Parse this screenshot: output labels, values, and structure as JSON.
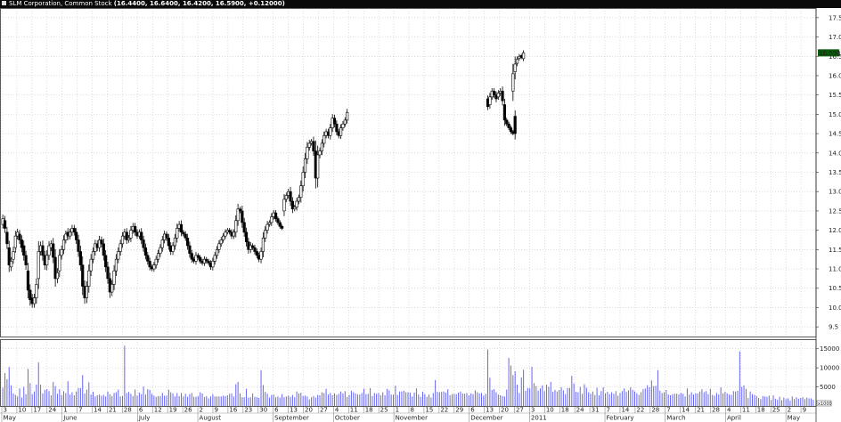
{
  "window": {
    "title": "SLM Corporation, Common Stock",
    "stats": "(16.4400, 16.6400, 16.4200, 16.5900, +0.12000)"
  },
  "colors": {
    "background": "#ffffff",
    "up_candle_fill": "#ffffff",
    "down_candle_fill": "#000000",
    "candle_outline": "#000000",
    "volume_bar": "#6666ee",
    "price_badge": "#0a5a0a",
    "grid": "#c8c8c8"
  },
  "chart_data": [
    {
      "type": "candlestick",
      "series_name": "SLM Corporation, Common Stock",
      "ylim": [
        9.25,
        17.75
      ],
      "y_ticks": [
        "9.5",
        "10.0",
        "10.5",
        "11.0",
        "11.5",
        "12.0",
        "12.5",
        "13.0",
        "13.5",
        "14.0",
        "14.5",
        "15.0",
        "15.5",
        "16.0",
        "16.5",
        "17.0",
        "17.5"
      ],
      "last_price_label": "16.5900",
      "grid": true,
      "segments": [
        {
          "start": 20100503,
          "count": 165,
          "close": [
            12.3,
            12.05,
            11.65,
            11.1,
            11.2,
            11.45,
            11.85,
            11.95,
            11.75,
            11.55,
            11.35,
            11.1,
            10.45,
            10.2,
            10.1,
            10.25,
            10.6,
            11.45,
            11.6,
            11.35,
            11.1,
            11.35,
            11.6,
            11.65,
            11.3,
            10.75,
            10.9,
            11.35,
            11.5,
            11.75,
            11.9,
            11.85,
            11.95,
            12.05,
            11.95,
            11.75,
            11.45,
            11.1,
            10.55,
            10.25,
            10.55,
            10.95,
            11.25,
            11.45,
            11.65,
            11.55,
            11.75,
            11.65,
            11.35,
            11.05,
            10.75,
            10.4,
            10.6,
            10.95,
            11.25,
            11.45,
            11.65,
            11.85,
            11.95,
            11.75,
            11.8,
            12.0,
            12.1,
            11.95,
            11.85,
            11.95,
            11.75,
            11.55,
            11.35,
            11.2,
            11.05,
            11.0,
            11.1,
            11.25,
            11.4,
            11.55,
            11.75,
            11.9,
            11.8,
            11.6,
            11.45,
            11.6,
            11.8,
            12.05,
            12.15,
            11.95,
            11.9,
            11.8,
            11.6,
            11.4,
            11.25,
            11.2,
            11.35,
            11.3,
            11.2,
            11.15,
            11.25,
            11.2,
            11.15,
            11.05,
            11.2,
            11.35,
            11.5,
            11.65,
            11.75,
            11.85,
            11.95,
            12.0,
            11.95,
            11.85,
            11.95,
            12.25,
            12.55,
            12.5,
            12.2,
            11.95,
            11.7,
            11.5,
            11.6,
            11.55,
            11.45,
            11.35,
            11.25,
            11.45,
            11.8,
            12.0,
            12.15,
            12.2,
            12.35,
            12.45,
            12.3,
            12.2,
            12.1,
            12.05,
            12.8,
            12.9,
            13.0,
            12.75,
            12.55,
            12.6,
            12.75,
            12.85,
            13.15,
            13.5,
            13.85,
            14.15,
            14.25,
            14.3,
            14.05,
            13.35,
            13.95,
            14.05,
            14.25,
            14.45,
            14.55,
            14.45,
            14.65,
            14.9,
            14.75,
            14.55,
            14.45,
            14.65,
            14.75,
            14.85,
            15.05
          ],
          "open_offset": [
            -0.15,
            0.2,
            0.3,
            0.45,
            -0.15,
            -0.2,
            -0.3,
            -0.1,
            0.15,
            0.2,
            0.25,
            0.25,
            0.5,
            0.25,
            0.15,
            -0.15,
            -0.35,
            -0.7,
            -0.15,
            0.25,
            0.25,
            -0.25,
            -0.25,
            -0.1,
            0.35,
            0.55,
            -0.15,
            -0.4,
            -0.15,
            -0.25,
            -0.15,
            0.1,
            -0.1,
            -0.1,
            0.1,
            0.2,
            0.3,
            0.35,
            0.55,
            0.3,
            -0.3,
            -0.4,
            -0.3,
            -0.2,
            -0.2,
            0.1,
            -0.2,
            0.1,
            0.3,
            0.3,
            0.3,
            0.35,
            -0.2,
            -0.35,
            -0.3,
            -0.2,
            -0.2,
            -0.2,
            -0.1,
            0.2,
            -0.05,
            -0.2,
            -0.1,
            0.15,
            0.1,
            -0.1,
            0.2,
            0.2,
            0.2,
            0.15,
            0.15,
            0.05,
            -0.1,
            -0.15,
            -0.15,
            -0.15,
            -0.2,
            -0.15,
            0.1,
            0.2,
            0.15,
            -0.15,
            -0.2,
            -0.25,
            -0.1,
            0.2,
            0.05,
            0.1,
            0.2,
            0.2,
            0.15,
            0.05,
            -0.15,
            0.05,
            0.1,
            0.05,
            -0.1,
            0.05,
            0.05,
            0.1,
            -0.15,
            -0.15,
            -0.15,
            -0.15,
            -0.1,
            -0.1,
            -0.1,
            -0.05,
            0.05,
            0.1,
            -0.1,
            -0.3,
            -0.3,
            0.05,
            0.3,
            0.25,
            0.25,
            0.2,
            -0.1,
            0.05,
            0.1,
            0.1,
            0.1,
            -0.2,
            -0.35,
            -0.2,
            -0.15,
            -0.05,
            -0.15,
            -0.1,
            0.15,
            0.1,
            0.1,
            0.05,
            -0.3,
            -0.1,
            -0.1,
            0.25,
            0.2,
            -0.05,
            -0.15,
            -0.1,
            -0.3,
            -0.35,
            -0.35,
            -0.3,
            -0.1,
            -0.05,
            0.25,
            0.7,
            -0.6,
            -0.1,
            -0.2,
            -0.2,
            -0.1,
            0.1,
            -0.2,
            -0.25,
            0.15,
            0.2,
            0.1,
            -0.2,
            -0.1,
            -0.1,
            -0.2
          ],
          "range": [
            0.35,
            0.4,
            0.45,
            0.6,
            0.35,
            0.4,
            0.45,
            0.3,
            0.35,
            0.4,
            0.45,
            0.4,
            0.7,
            0.5,
            0.35,
            0.35,
            0.5,
            0.9,
            0.35,
            0.45,
            0.4,
            0.45,
            0.4,
            0.3,
            0.5,
            0.7,
            0.4,
            0.55,
            0.35,
            0.4,
            0.3,
            0.35,
            0.3,
            0.3,
            0.3,
            0.35,
            0.45,
            0.5,
            0.75,
            0.5,
            0.45,
            0.55,
            0.45,
            0.35,
            0.35,
            0.3,
            0.35,
            0.3,
            0.45,
            0.45,
            0.45,
            0.5,
            0.35,
            0.5,
            0.45,
            0.35,
            0.35,
            0.35,
            0.3,
            0.35,
            0.25,
            0.35,
            0.3,
            0.3,
            0.25,
            0.25,
            0.35,
            0.35,
            0.35,
            0.3,
            0.3,
            0.2,
            0.25,
            0.3,
            0.3,
            0.3,
            0.35,
            0.3,
            0.25,
            0.35,
            0.3,
            0.3,
            0.35,
            0.4,
            0.3,
            0.35,
            0.2,
            0.25,
            0.35,
            0.35,
            0.3,
            0.2,
            0.3,
            0.2,
            0.2,
            0.2,
            0.25,
            0.2,
            0.2,
            0.25,
            0.3,
            0.3,
            0.3,
            0.3,
            0.25,
            0.25,
            0.25,
            0.2,
            0.2,
            0.25,
            0.25,
            0.45,
            0.45,
            0.2,
            0.45,
            0.4,
            0.4,
            0.35,
            0.3,
            0.2,
            0.25,
            0.25,
            0.25,
            0.35,
            0.5,
            0.35,
            0.3,
            0.2,
            0.3,
            0.25,
            0.25,
            0.2,
            0.2,
            0.15,
            0.45,
            0.25,
            0.25,
            0.4,
            0.35,
            0.2,
            0.3,
            0.25,
            0.45,
            0.5,
            0.5,
            0.45,
            0.3,
            0.2,
            0.4,
            0.9,
            0.8,
            0.3,
            0.35,
            0.35,
            0.25,
            0.25,
            0.35,
            0.35,
            0.3,
            0.3,
            0.25,
            0.3,
            0.25,
            0.25,
            0.3
          ]
        },
        {
          "start": 20110401,
          "count": 14,
          "close": [
            15.2,
            15.45,
            15.6,
            15.5,
            15.4,
            15.55,
            15.6,
            15.35,
            14.85,
            14.75,
            14.65,
            14.55,
            14.5,
            14.5
          ],
          "open_offset": [
            0.2,
            -0.2,
            -0.15,
            0.1,
            0.1,
            -0.1,
            -0.05,
            0.25,
            0.4,
            0.1,
            0.1,
            0.1,
            0.05,
            0.45
          ],
          "range": [
            0.3,
            0.35,
            0.25,
            0.25,
            0.3,
            0.25,
            0.25,
            0.4,
            0.5,
            0.2,
            0.2,
            0.2,
            0.15,
            0.5
          ]
        },
        {
          "start": 20110421,
          "count": 6,
          "close": [
            16.05,
            16.3,
            16.42,
            16.5,
            16.47,
            16.59
          ],
          "open_offset": [
            -0.45,
            -0.2,
            -0.1,
            -0.05,
            0.05,
            -0.15
          ],
          "range": [
            0.85,
            0.65,
            0.25,
            0.2,
            0.15,
            0.22
          ]
        }
      ]
    },
    {
      "type": "bar",
      "series_name": "Volume",
      "ylim": [
        0,
        17500
      ],
      "y_ticks": [
        "5000",
        "10000",
        "15000"
      ],
      "unit_label": "x1000",
      "values": [
        4800,
        8600,
        7000,
        10200,
        5400,
        3300,
        2900,
        2500,
        4600,
        2200,
        5000,
        3100,
        9700,
        6000,
        3100,
        3800,
        5600,
        11400,
        5600,
        3300,
        4200,
        4400,
        3900,
        2800,
        6300,
        5200,
        3200,
        4400,
        2900,
        3900,
        3400,
        6500,
        3000,
        3600,
        2800,
        3800,
        4700,
        4700,
        8100,
        3300,
        4300,
        6200,
        3000,
        3700,
        2500,
        2800,
        3000,
        2700,
        2900,
        2500,
        3800,
        3100,
        2600,
        3400,
        3600,
        4300,
        2500,
        2600,
        15800,
        3400,
        3700,
        3200,
        2600,
        4300,
        2700,
        3500,
        3100,
        5100,
        3000,
        4400,
        4200,
        3200,
        2700,
        2400,
        2600,
        2600,
        3400,
        2700,
        2700,
        4300,
        3600,
        3300,
        2500,
        3400,
        2600,
        3400,
        2500,
        3200,
        2400,
        3100,
        3400,
        2400,
        2400,
        2600,
        3600,
        3300,
        2300,
        2600,
        2000,
        2500,
        3100,
        2500,
        2500,
        2500,
        2500,
        2700,
        2600,
        2800,
        3200,
        3300,
        2500,
        5700,
        6300,
        3300,
        2300,
        2300,
        4500,
        2200,
        2300,
        3300,
        2400,
        2300,
        2100,
        9400,
        5500,
        3700,
        3200,
        2200,
        2900,
        3000,
        2300,
        2500,
        2200,
        3100,
        2300,
        2500,
        2700,
        2400,
        2900,
        2300,
        3800,
        3300,
        3500,
        2600,
        2700,
        2500,
        1700,
        2300,
        2600,
        2200,
        2900,
        2800,
        3600,
        3400,
        4500,
        3000,
        3400,
        2800,
        3300,
        2900,
        3200,
        3800,
        3300,
        3900,
        2400,
        2900,
        4000,
        3600,
        3300,
        3000,
        3000,
        3400,
        4500,
        3100,
        3200,
        4700,
        2600,
        3400,
        3200,
        3400,
        2800,
        3600,
        2800,
        4500,
        4100,
        3000,
        3000,
        5300,
        2900,
        3800,
        3800,
        4000,
        3600,
        3600,
        3500,
        2500,
        3500,
        4600,
        3000,
        2400,
        3700,
        3100,
        2400,
        3000,
        2200,
        3400,
        6800,
        3700,
        3600,
        3700,
        3800,
        3500,
        4400,
        2800,
        3100,
        3200,
        3100,
        3500,
        3800,
        3300,
        3200,
        3400,
        2800,
        3300,
        3100,
        4100,
        3600,
        3300,
        3400,
        2700,
        3200,
        14800,
        7400,
        4200,
        4400,
        3600,
        3000,
        2800,
        2600,
        2500,
        4300,
        12600,
        10600,
        8100,
        9100,
        5600,
        3400,
        7500,
        9500,
        4000,
        4700,
        4600,
        10300,
        6000,
        5200,
        4000,
        4600,
        5400,
        3900,
        5600,
        5000,
        6300,
        3700,
        4200,
        3800,
        4200,
        4900,
        4100,
        3100,
        4700,
        4700,
        7900,
        5900,
        3700,
        3600,
        5000,
        3200,
        5700,
        4800,
        3600,
        3200,
        3800,
        2900,
        4800,
        2800,
        3900,
        4900,
        3300,
        3700,
        3100,
        3600,
        3200,
        3900,
        2700,
        3400,
        3900,
        4600,
        3700,
        4100,
        4900,
        4200,
        3800,
        3300,
        2900,
        3600,
        4400,
        4600,
        5400,
        4900,
        6700,
        5200,
        5300,
        9400,
        4000,
        3400,
        3600,
        4200,
        3000,
        2800,
        3100,
        3200,
        3200,
        3000,
        3400,
        3200,
        2500,
        4600,
        3000,
        3600,
        3000,
        3300,
        3300,
        3800,
        4400,
        3600,
        3900,
        3100,
        4500,
        2900,
        2700,
        3400,
        3000,
        4900,
        3300,
        3700,
        3300,
        3000,
        2900,
        3900,
        3800,
        4000,
        14300,
        5000,
        5400,
        4500,
        2100,
        3800,
        3100,
        2900,
        2600,
        2100,
        1800,
        2600,
        2500,
        2400,
        2700,
        1600,
        2800,
        1900,
        1600,
        2400,
        1500,
        2200,
        1800,
        2000,
        1400,
        2500,
        1800,
        2300,
        1900,
        2100,
        2300,
        1800,
        2200,
        2000,
        2000,
        1600
      ]
    }
  ],
  "x_axis": {
    "day_ticks": [
      "3",
      "10",
      "17",
      "24",
      "1",
      "7",
      "14",
      "21",
      "28",
      "6",
      "12",
      "19",
      "26",
      "2",
      "9",
      "16",
      "23",
      "30",
      "6",
      "13",
      "20",
      "27",
      "4",
      "11",
      "18",
      "25",
      "1",
      "8",
      "15",
      "22",
      "29",
      "6",
      "13",
      "20",
      "27",
      "3",
      "10",
      "18",
      "24",
      "31",
      "7",
      "14",
      "22",
      "28",
      "7",
      "14",
      "21",
      "28",
      "4",
      "11",
      "18",
      "25",
      "2",
      "9"
    ],
    "month_labels": [
      "May",
      "June",
      "July",
      "August",
      "September",
      "October",
      "November",
      "December",
      "2011",
      "February",
      "March",
      "April",
      "May"
    ]
  }
}
